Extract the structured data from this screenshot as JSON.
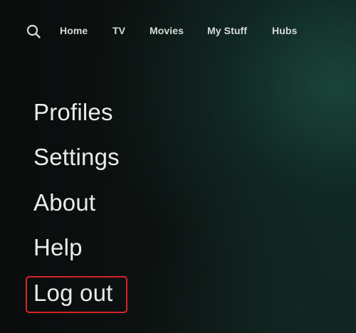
{
  "nav": {
    "search_icon": "search-icon",
    "items": [
      {
        "label": "Home"
      },
      {
        "label": "TV"
      },
      {
        "label": "Movies"
      },
      {
        "label": "My Stuff"
      },
      {
        "label": "Hubs"
      }
    ]
  },
  "menu": {
    "items": [
      {
        "label": "Profiles"
      },
      {
        "label": "Settings"
      },
      {
        "label": "About"
      },
      {
        "label": "Help"
      },
      {
        "label": "Log out"
      }
    ],
    "highlighted_item": "Log out",
    "highlight_color": "#d9232a"
  }
}
